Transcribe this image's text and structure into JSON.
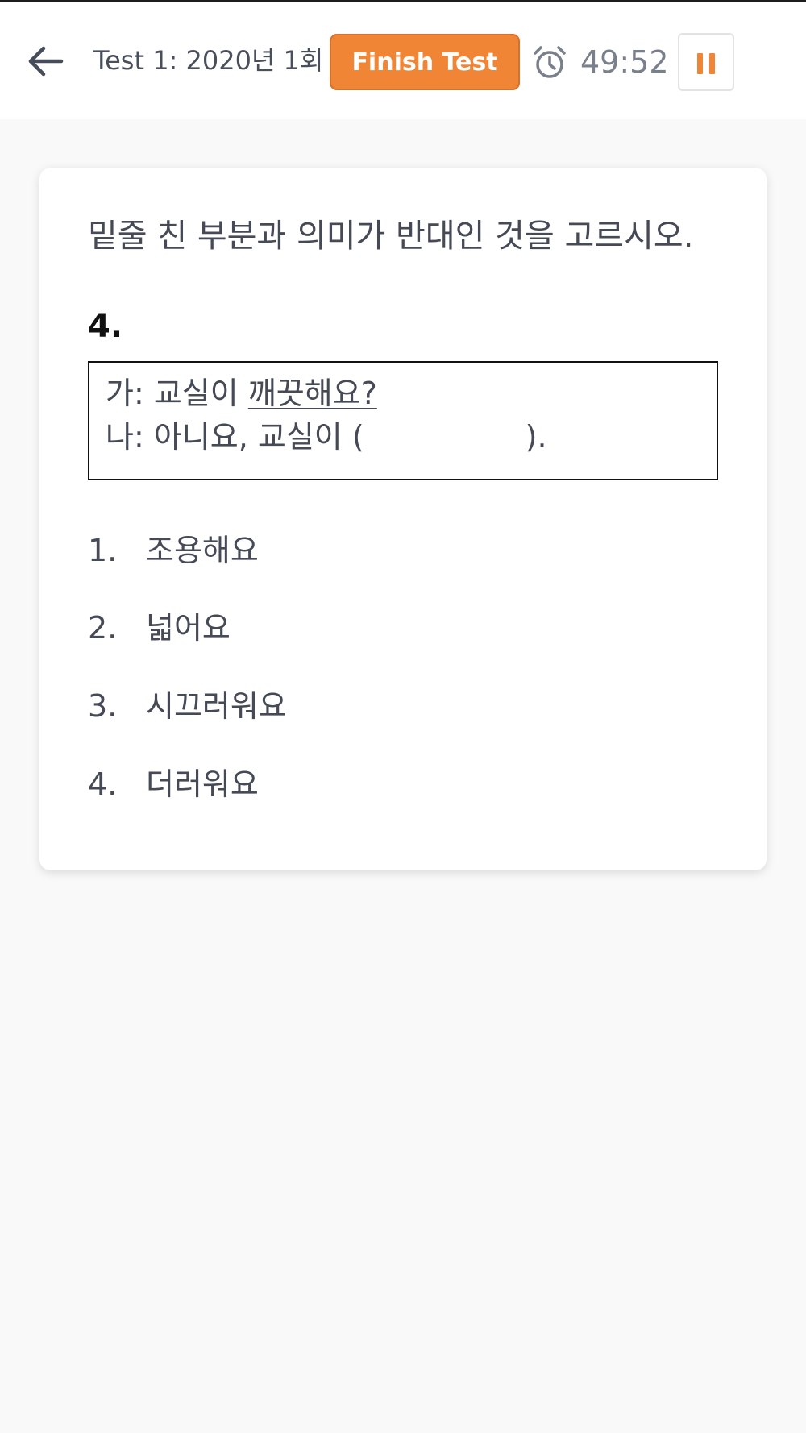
{
  "header": {
    "test_title": "Test 1: 2020년 1회",
    "finish_label": "Finish Test",
    "timer": "49:52",
    "back_icon": "arrow-left-icon",
    "clock_icon": "alarm-clock-icon",
    "pause_icon": "pause-icon"
  },
  "question": {
    "instruction": "밑줄 친 부분과 의미가 반대인 것을 고르시오.",
    "number": "4.",
    "dialog": {
      "line1_prefix": "가: 교실이 ",
      "line1_underlined": "깨끗해요?",
      "line2_prefix": "나: 아니요, 교실이 (",
      "line2_suffix": ")."
    },
    "options": [
      {
        "num": "1.",
        "text": "조용해요"
      },
      {
        "num": "2.",
        "text": "넓어요"
      },
      {
        "num": "3.",
        "text": "시끄러워요"
      },
      {
        "num": "4.",
        "text": "더러워요"
      }
    ]
  },
  "colors": {
    "accent": "#ef8535",
    "background": "#f9f9f9",
    "card": "#ffffff",
    "text": "#454a56",
    "timer_text": "#7a7f8c"
  }
}
